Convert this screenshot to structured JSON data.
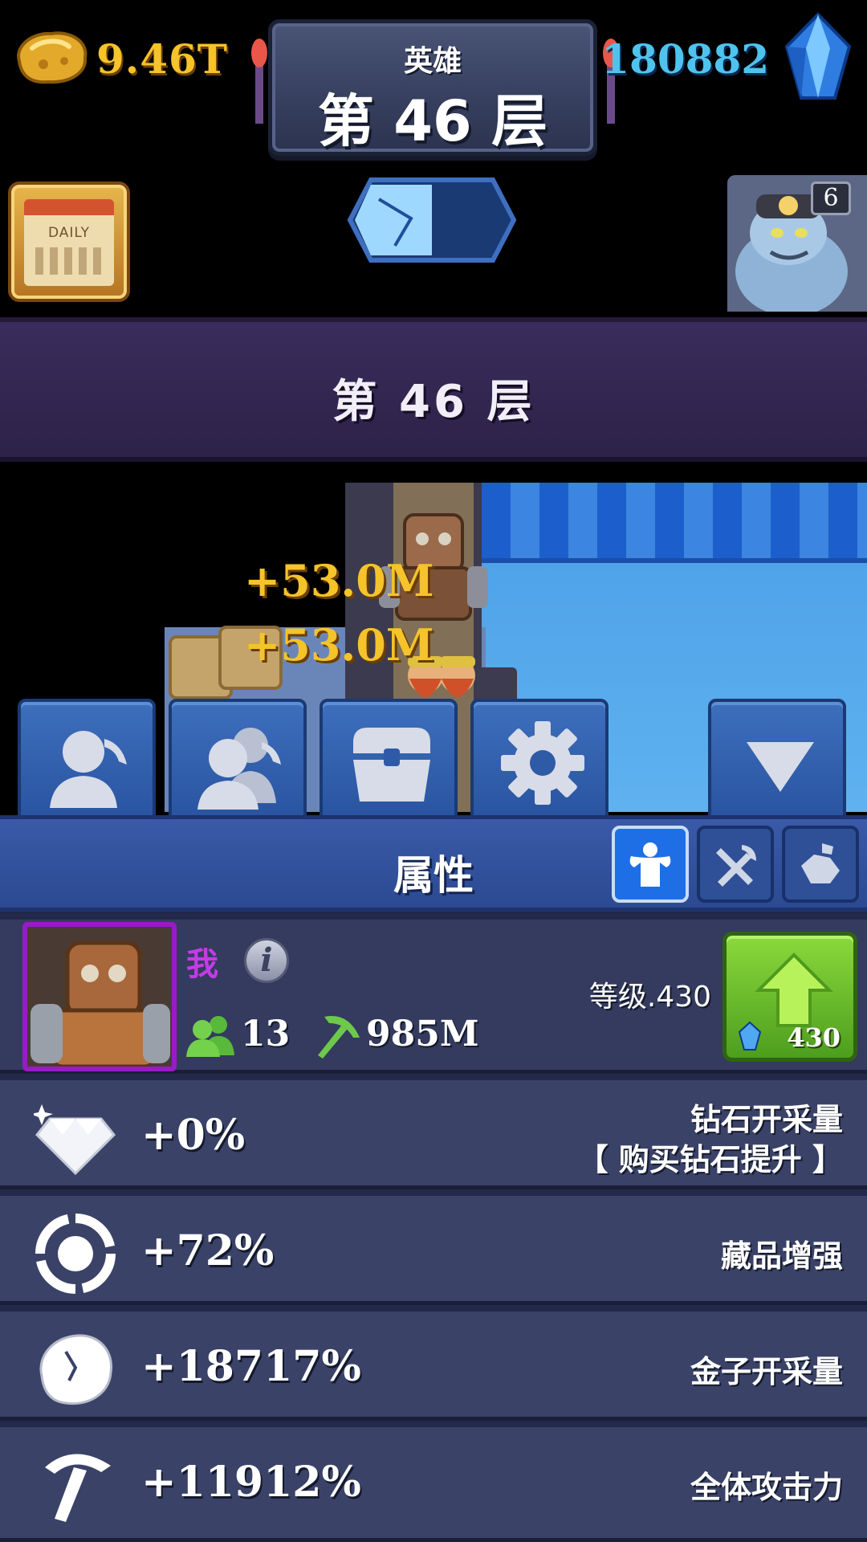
{
  "hud": {
    "gold_amount": "9.46T",
    "gem_amount": "180882",
    "mode_label": "英雄",
    "floor_label": "第 46 层",
    "daily_label": "DAILY",
    "boss_count": "6",
    "floor_progress": 0.5
  },
  "banner": {
    "floor_title": "第 46 层"
  },
  "scene": {
    "gains": [
      "+53.0M",
      "+53.0M"
    ]
  },
  "tabs": [
    {
      "icon": "miner-icon",
      "active": true
    },
    {
      "icon": "workers-icon",
      "active": false
    },
    {
      "icon": "chest-icon",
      "active": false
    },
    {
      "icon": "gear-icon",
      "active": false
    },
    {
      "icon": "collapse-arrow-icon",
      "active": false
    }
  ],
  "panel": {
    "title": "属性",
    "sub_tabs": [
      {
        "icon": "strength-icon",
        "active": true
      },
      {
        "icon": "crossed-tools-icon",
        "active": false
      },
      {
        "icon": "ore-icon",
        "active": false
      }
    ]
  },
  "profile": {
    "name": "我",
    "workers": "13",
    "power": "985M",
    "level": "等级.430",
    "upgrade_cost": "430"
  },
  "stats": [
    {
      "icon": "diamond-icon",
      "value": "+0%",
      "label_line1": "钻石开采量",
      "label_line2": "【 购买钻石提升 】"
    },
    {
      "icon": "artifact-icon",
      "value": "+72%",
      "label": "藏品增强"
    },
    {
      "icon": "gold-ore-icon",
      "value": "+18717%",
      "label": "金子开采量"
    },
    {
      "icon": "pickaxe-icon",
      "value": "+11912%",
      "label": "全体攻击力"
    }
  ],
  "colors": {
    "gold": "#f5c32a",
    "gem": "#4fc3ee",
    "name": "#c13ce6",
    "upgrade": "#6bbd2c"
  }
}
